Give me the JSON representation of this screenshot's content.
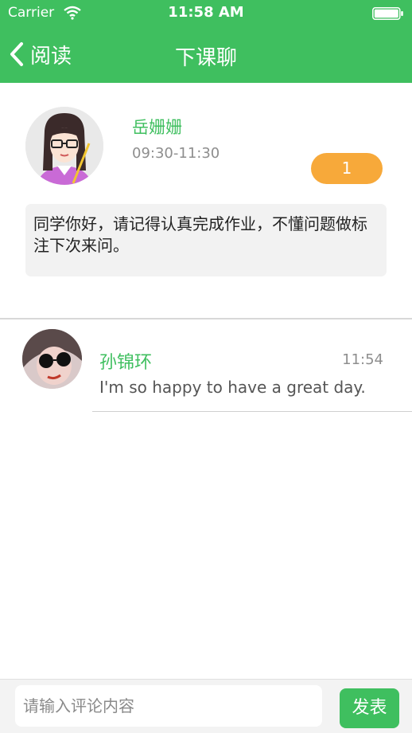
{
  "status_bar": {
    "carrier": "Carrier",
    "time": "11:58 AM",
    "icons": [
      "wifi-icon",
      "battery-icon"
    ]
  },
  "nav": {
    "back_label": "阅读",
    "title": "下课聊",
    "back_icon": "chevron-left-icon"
  },
  "post": {
    "teacher_name": "岳姗姗",
    "time_range": "09:30-11:30",
    "count": "1",
    "message": "同学你好，请记得认真完成作业，不懂问题做标注下次来问。",
    "avatar_icon": "teacher-avatar-illustration"
  },
  "comments": [
    {
      "name": "孙锦环",
      "time": "11:54",
      "text": "I'm so happy to have a great day."
    }
  ],
  "input": {
    "placeholder": "请输入评论内容",
    "send_label": "发表"
  },
  "colors": {
    "brand_green": "#3fbf5f",
    "badge_orange": "#f7a93a",
    "bubble_gray": "#f2f2f2"
  }
}
